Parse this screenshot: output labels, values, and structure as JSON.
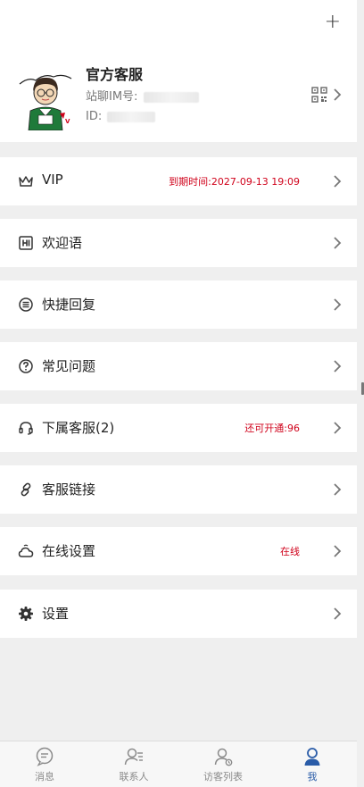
{
  "header": {
    "add_label": "+"
  },
  "profile": {
    "name": "官方客服",
    "im_label": "站聊IM号:",
    "id_label": "ID:"
  },
  "menu": [
    {
      "label": "VIP",
      "icon": "crown-icon",
      "extra": "到期时间:2027-09-13 19:09"
    },
    {
      "label": "欢迎语",
      "icon": "welcome-icon",
      "extra": ""
    },
    {
      "label": "快捷回复",
      "icon": "list-icon",
      "extra": ""
    },
    {
      "label": "常见问题",
      "icon": "question-icon",
      "extra": ""
    },
    {
      "label": "下属客服(2)",
      "icon": "headset-icon",
      "extra": "还可开通:96"
    },
    {
      "label": "客服链接",
      "icon": "link-icon",
      "extra": ""
    },
    {
      "label": "在线设置",
      "icon": "cloud-icon",
      "extra": "在线"
    },
    {
      "label": "设置",
      "icon": "gear-icon",
      "extra": ""
    }
  ],
  "tabs": [
    {
      "label": "消息",
      "icon": "chat-icon"
    },
    {
      "label": "联系人",
      "icon": "contacts-icon"
    },
    {
      "label": "访客列表",
      "icon": "visitor-icon"
    },
    {
      "label": "我",
      "icon": "profile-icon"
    }
  ],
  "colors": {
    "accent": "#2a5ca8",
    "extra_text": "#d0021b",
    "background": "#efefef"
  }
}
